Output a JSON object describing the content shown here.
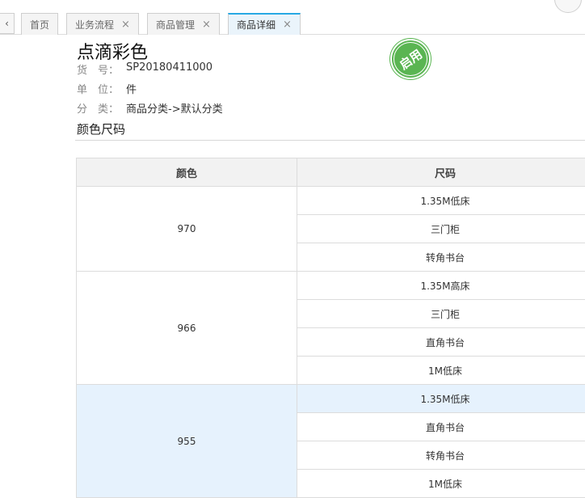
{
  "tabs": {
    "nav_prev": "‹",
    "items": [
      {
        "label": "首页",
        "closable": false,
        "active": false
      },
      {
        "label": "业务流程",
        "closable": true,
        "active": false
      },
      {
        "label": "商品管理",
        "closable": true,
        "active": false
      },
      {
        "label": "商品详细",
        "closable": true,
        "active": true
      }
    ],
    "close_glyph": "×"
  },
  "product": {
    "name": "点滴彩色",
    "status_stamp": "启用",
    "fields": [
      {
        "label": "货　号：",
        "value": "SP20180411000"
      },
      {
        "label": "单　位：",
        "value": "件"
      },
      {
        "label": "分　类：",
        "value": "商品分类->默认分类"
      }
    ]
  },
  "section": {
    "title": "颜色尺码"
  },
  "table": {
    "headers": [
      "颜色",
      "尺码"
    ],
    "groups": [
      {
        "color": "970",
        "sizes": [
          "1.35M低床",
          "三门柜",
          "转角书台"
        ],
        "highlighted": false
      },
      {
        "color": "966",
        "sizes": [
          "1.35M高床",
          "三门柜",
          "直角书台",
          "1M低床"
        ],
        "highlighted": false
      },
      {
        "color": "955",
        "sizes": [
          "1.35M低床",
          "直角书台",
          "转角书台",
          "1M低床"
        ],
        "highlighted": true
      }
    ]
  },
  "colors": {
    "accent": "#27a9e3",
    "stamp_green": "#5ab552",
    "highlight": "#e6f2fd"
  }
}
